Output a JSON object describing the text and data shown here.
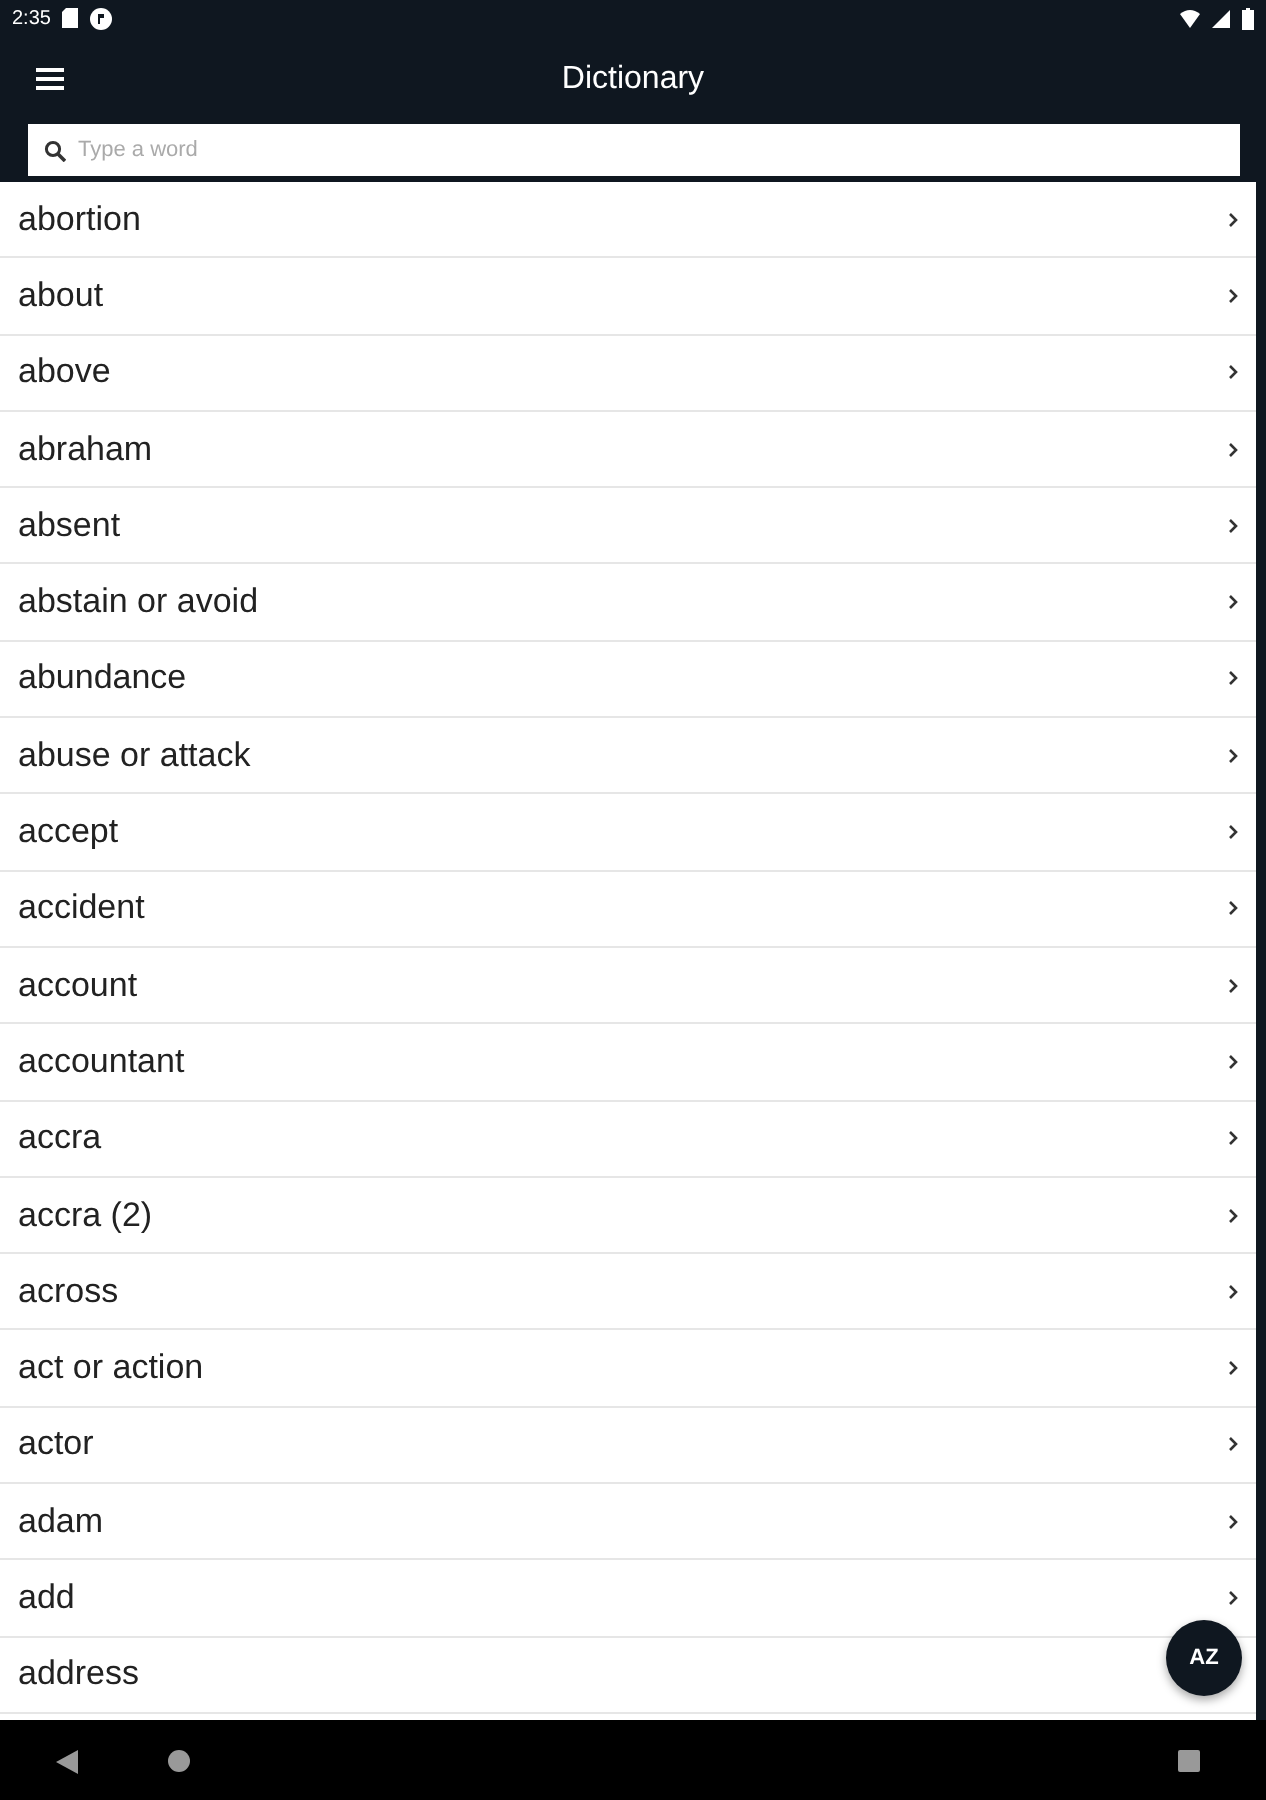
{
  "status_bar": {
    "time": "2:35"
  },
  "app_bar": {
    "title": "Dictionary"
  },
  "search": {
    "placeholder": "Type a word"
  },
  "words": [
    "abortion",
    "about",
    "above",
    "abraham",
    "absent",
    "abstain or avoid",
    "abundance",
    "abuse or attack",
    "accept",
    "accident",
    "account",
    "accountant",
    "accra",
    "accra (2)",
    "across",
    "act or action",
    "actor",
    "adam",
    "add",
    "address"
  ],
  "fab": {
    "label": "AZ"
  }
}
